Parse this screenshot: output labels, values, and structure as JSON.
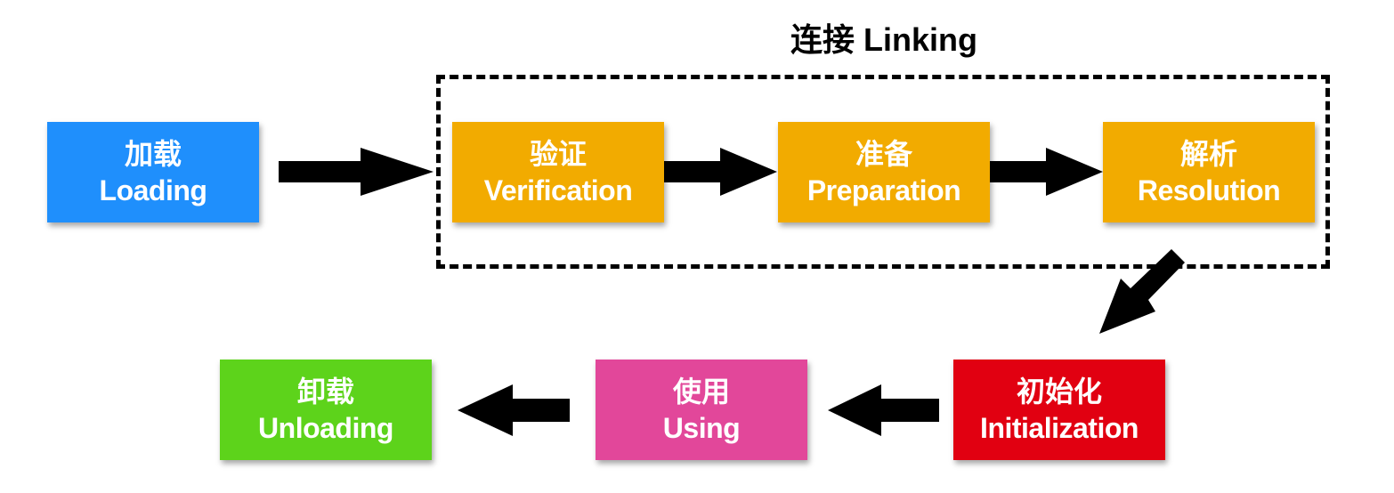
{
  "group": {
    "title": "连接 Linking"
  },
  "stages": [
    {
      "id": "loading",
      "zh": "加载",
      "en": "Loading",
      "color": "#1f8ffc"
    },
    {
      "id": "verification",
      "zh": "验证",
      "en": "Verification",
      "color": "#f2ab00"
    },
    {
      "id": "preparation",
      "zh": "准备",
      "en": "Preparation",
      "color": "#f2ab00"
    },
    {
      "id": "resolution",
      "zh": "解析",
      "en": "Resolution",
      "color": "#f2ab00"
    },
    {
      "id": "initialization",
      "zh": "初始化",
      "en": "Initialization",
      "color": "#e10011"
    },
    {
      "id": "using",
      "zh": "使用",
      "en": "Using",
      "color": "#e2479a"
    },
    {
      "id": "unloading",
      "zh": "卸载",
      "en": "Unloading",
      "color": "#5dd31b"
    }
  ],
  "flow": [
    "loading",
    "verification",
    "preparation",
    "resolution",
    "initialization",
    "using",
    "unloading"
  ]
}
